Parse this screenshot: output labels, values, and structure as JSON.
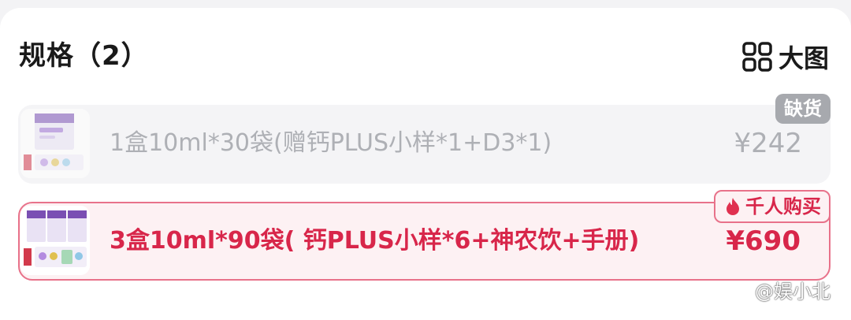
{
  "header": {
    "title": "规格（2）",
    "view_toggle_label": "大图",
    "view_toggle_icon": "grid-icon"
  },
  "specs": [
    {
      "name": "1盒10ml*30袋(赠钙PLUS小样*1+D3*1)",
      "price": "¥242",
      "badge": "缺货",
      "state": "out-of-stock"
    },
    {
      "name": "3盒10ml*90袋( 钙PLUS小样*6+神农饮+手册)",
      "price": "¥690",
      "badge": "千人购买",
      "badge_icon": "flame-icon",
      "state": "selected"
    }
  ],
  "watermark": {
    "text": "@娱小北",
    "icon": "paw-icon"
  },
  "colors": {
    "accent": "#d8264a",
    "selected_border": "#e8728a",
    "selected_bg": "#fdf1f3",
    "disabled_text": "#aeb0b5",
    "out_of_stock_badge": "#a7a9ae"
  }
}
